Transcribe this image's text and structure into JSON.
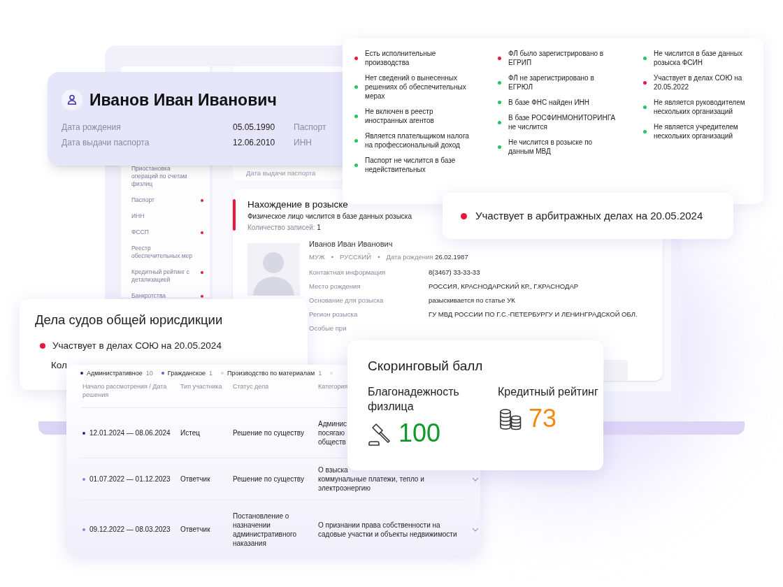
{
  "laptop": {
    "sidebar": [
      {
        "label": "Приостановка операций по счетам физлиц",
        "alert": false
      },
      {
        "label": "Паспорт",
        "alert": true
      },
      {
        "label": "ИНН",
        "alert": false
      },
      {
        "label": "ФССП",
        "alert": true
      },
      {
        "label": "Реестр обеспечительных мер",
        "alert": false
      },
      {
        "label": "Кредитный рейтинг с детализацией",
        "alert": true
      },
      {
        "label": "Банкротства",
        "alert": true
      }
    ],
    "passport_label": "Дата выдачи паспорта",
    "wanted": {
      "title": "Нахождение в розыске",
      "subtitle": "Физическое лицо числится в базе данных розыска",
      "count_label": "Количество записей:",
      "count": "1",
      "name": "Иванов Иван Иванович",
      "separators": [
        "•",
        "•"
      ],
      "gender": "МУЖ",
      "nationality": "РУССКИЙ",
      "birth_label": "Дата рождения",
      "birth_date": "26.02.1987",
      "details": [
        {
          "label": "Контактная информация",
          "value": "8(3467) 33-33-33"
        },
        {
          "label": "Место рождения",
          "value": "РОССИЯ, КРАСНОДАРСКИЙ КР., Г.КРАСНОДАР"
        },
        {
          "label": "Основание для розыска",
          "value": "разыскивается по статье УК"
        },
        {
          "label": "Регион розыска",
          "value": "ГУ МВД РОССИИ ПО Г.С.-ПЕТЕРБУРГУ И ЛЕНИНГРАДСКОЙ ОБЛ."
        },
        {
          "label": "Особые при"
        }
      ]
    }
  },
  "person": {
    "name": "Иванов Иван Иванович",
    "rows": [
      {
        "label": "Дата рождения",
        "value": "05.05.1990",
        "label_2": "Паспорт"
      },
      {
        "label": "Дата выдачи паспорта",
        "value": "12.06.2010",
        "label_2": "ИНН"
      }
    ]
  },
  "checks": {
    "columns": [
      [
        {
          "text": "Есть исполнительные производства",
          "color": "#e8173f"
        },
        {
          "text": "Нет сведений о вынесенных решениях об обеспечительных мерах",
          "color": "#22c55e"
        },
        {
          "text": "Не включен в реестр иностранных агентов",
          "color": "#22c55e"
        },
        {
          "text": "Является плательщиком налога на профессиональный доход",
          "color": "#22c55e"
        },
        {
          "text": "Паспорт не числится в базе недействительных",
          "color": "#22c55e"
        }
      ],
      [
        {
          "text": "ФЛ было зарегистрировано в ЕГРИП",
          "color": "#e8173f"
        },
        {
          "text": "ФЛ не зарегистрировано в ЕГРЮЛ",
          "color": "#22c55e"
        },
        {
          "text": "В базе ФНС найден ИНН",
          "color": "#22c55e"
        },
        {
          "text": "В базе РОСФИНМОНИТОРИНГА не числится",
          "color": "#22c55e"
        },
        {
          "text": "Не числится в розыске по данным МВД",
          "color": "#22c55e"
        }
      ],
      [
        {
          "text": "Не числится в базе данных розыска ФСИН",
          "color": "#22c55e"
        },
        {
          "text": "Участвует в делах СОЮ на 20.05.2022",
          "color": "#e8173f"
        },
        {
          "text": "Не является руководителем нескольких  организаций",
          "color": "#22c55e"
        },
        {
          "text": "Не является учредителем нескольких  организаций",
          "color": "#22c55e"
        }
      ]
    ]
  },
  "arbitration": {
    "text": "Участвует в арбитражных делах на 20.05.2024",
    "color": "#e8173f"
  },
  "courts": {
    "title": "Дела судов общей юрисдикции",
    "status": {
      "text": "Участвует в делах СОЮ на 20.05.2024",
      "color": "#e8173f"
    },
    "count_label": "Кол"
  },
  "cases": {
    "legend": [
      {
        "label": "Административное",
        "count": "10",
        "color": "#2a1f8c"
      },
      {
        "label": "Гражданское",
        "count": "1",
        "color": "#6656e0"
      },
      {
        "label": "Производство по материалам",
        "count": "1",
        "color": "#d9d3f7"
      },
      {
        "color": "#e4e0f8"
      }
    ],
    "columns": [
      "Начало рассмотрения / Дата решения",
      "Тип участника",
      "Статус дела",
      "Категория"
    ],
    "rows": [
      {
        "color": "#2a1f8c",
        "dates": "12.01.2024 — 08.06.2024",
        "participant": "Истец",
        "status": "Решение по существу",
        "category": "Админис\nпосягаю\nобществ",
        "chevron": false
      },
      {
        "color": "#8f80d6",
        "dates": "01.07.2022 — 01.12.2023",
        "participant": "Ответчик",
        "status": "Решение по существу",
        "category": "О взыска\nкоммунальные платежи, тепло и\nэлектроэнергию",
        "chevron": true
      },
      {
        "color": "#8f80d6",
        "dates": "09.12.2022 — 08.03.2023",
        "participant": "Ответчик",
        "status": "Постановление о назначении административного наказания",
        "category": "О признании права собственности на садовые участки и объекты недвижимости",
        "chevron": true
      }
    ]
  },
  "scoring": {
    "title": "Скоринговый балл",
    "metrics": [
      {
        "kind": "reliability",
        "label": "Благонадежность физлица",
        "value": "100",
        "color": "#0f9a2a"
      },
      {
        "kind": "credit",
        "label": "Кредитный рейтинг",
        "value": "73",
        "color": "#f7870f"
      }
    ]
  }
}
